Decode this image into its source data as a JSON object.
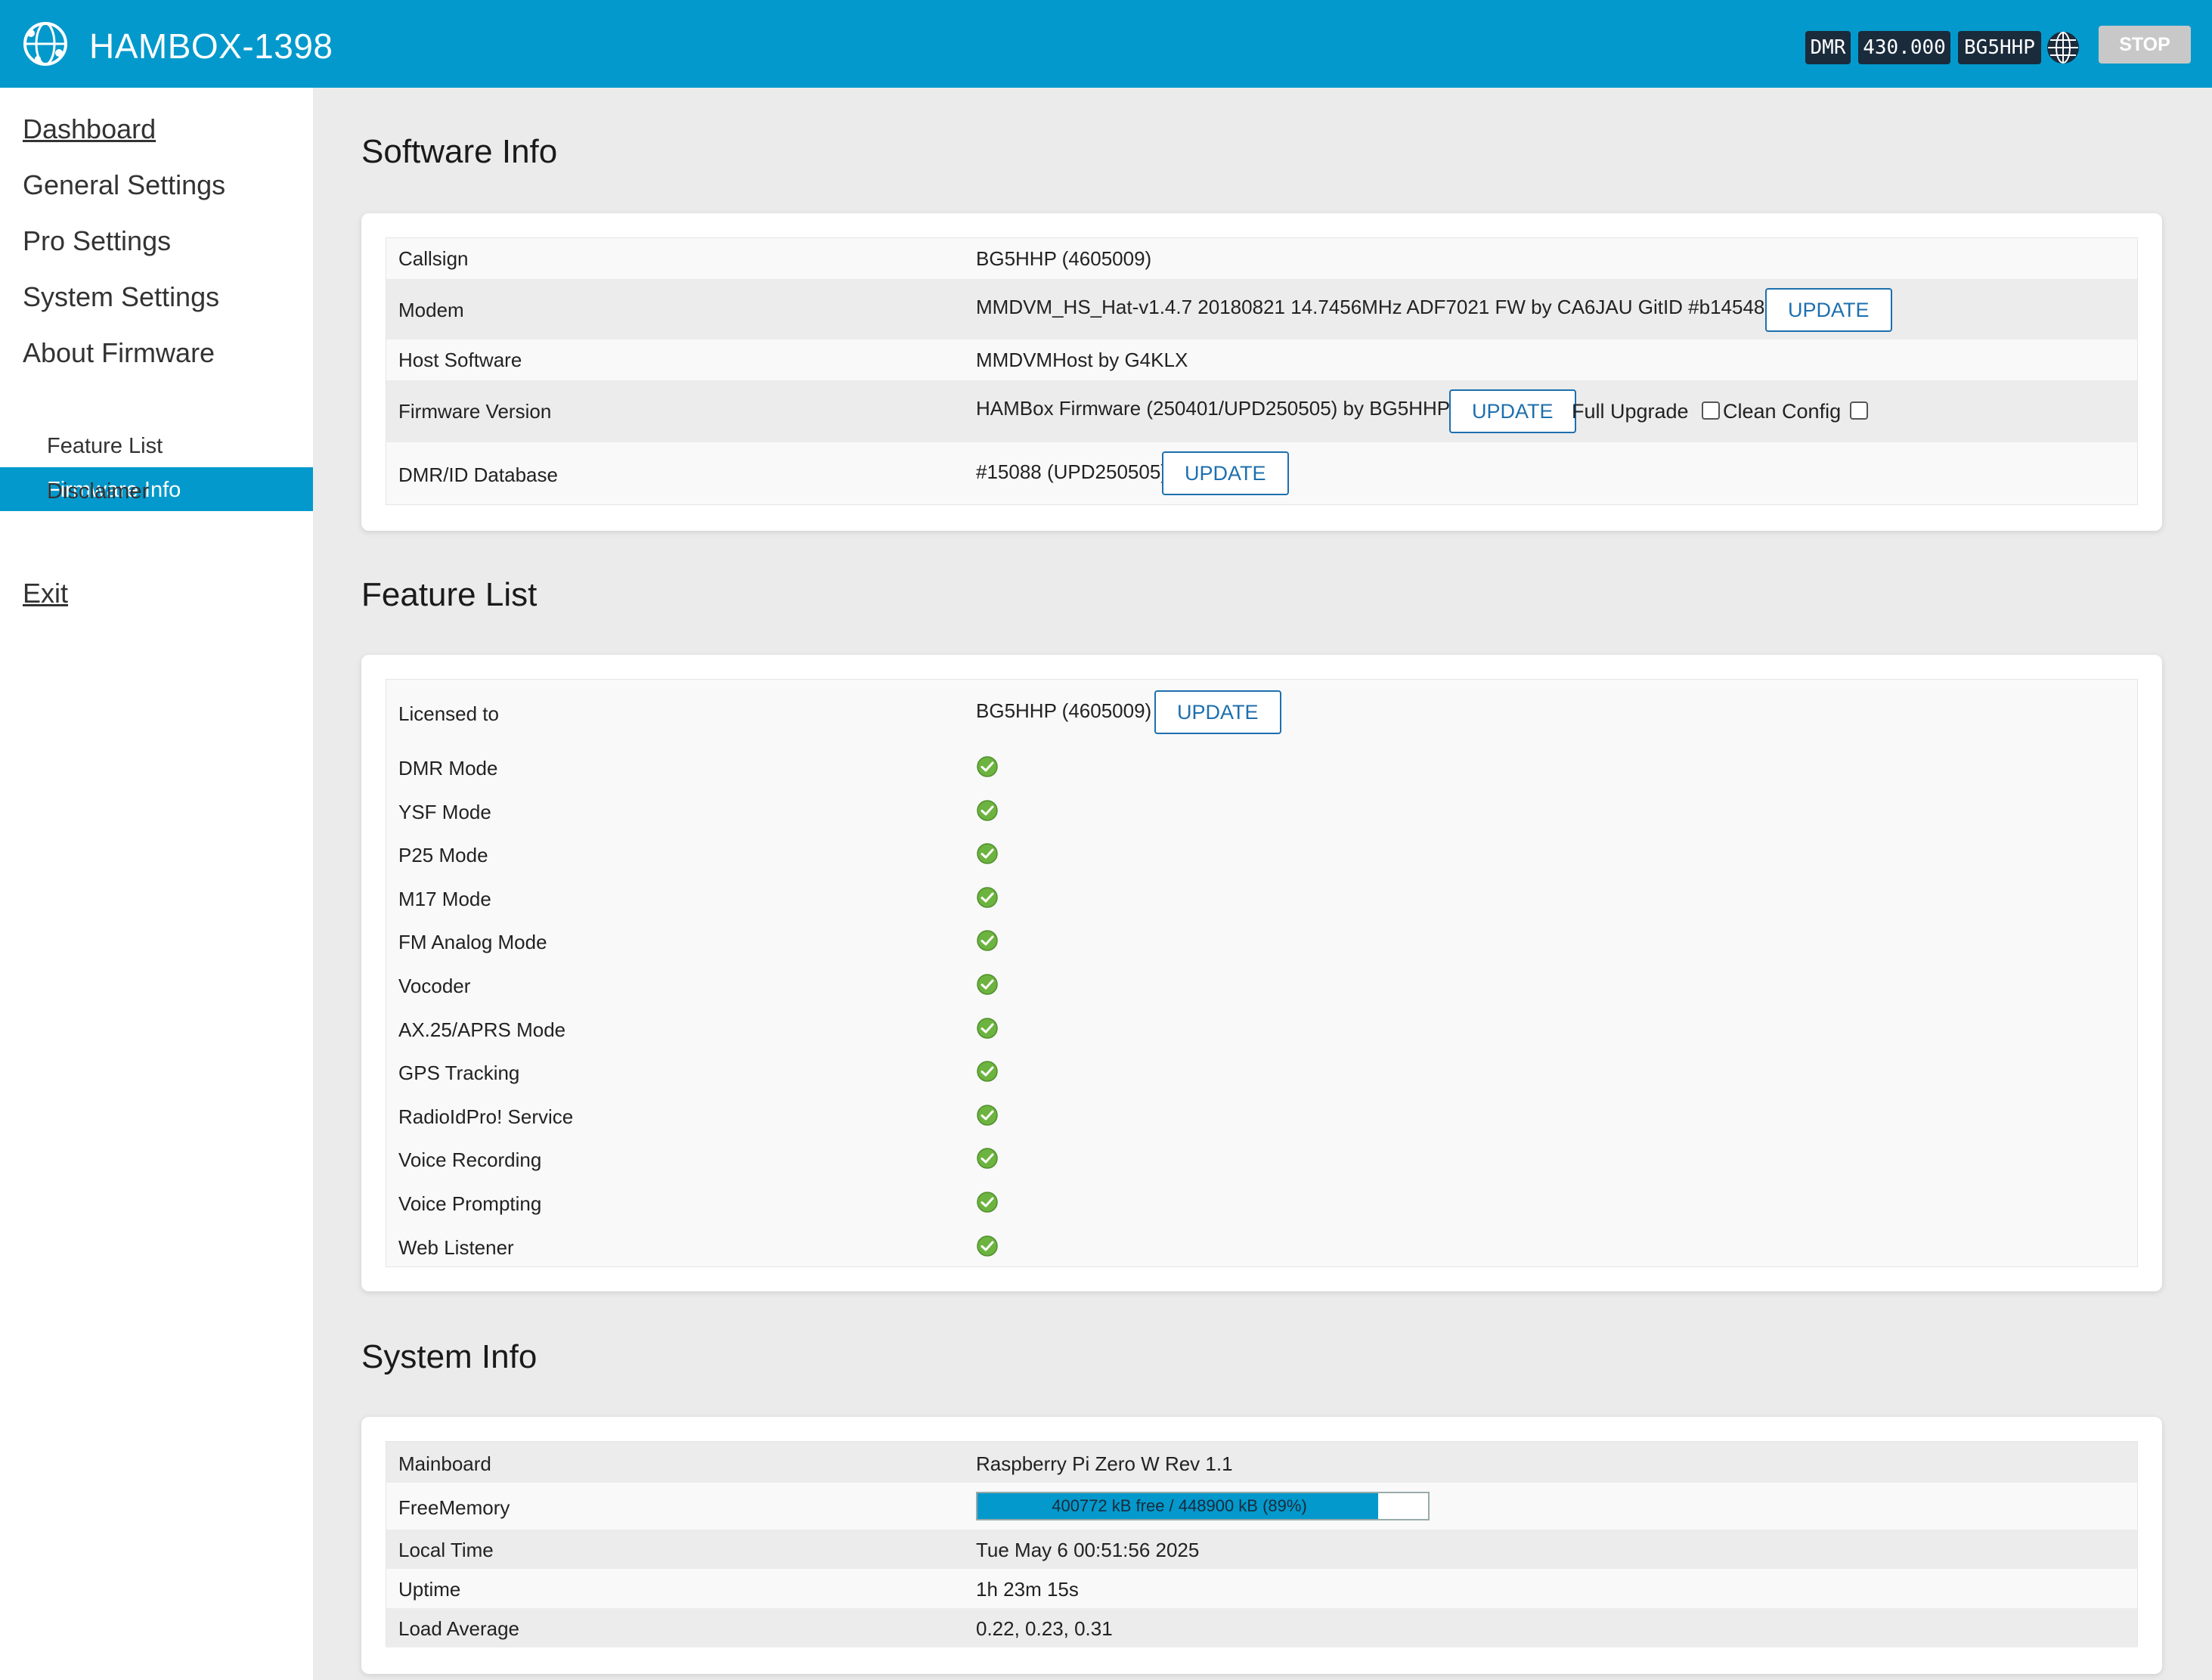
{
  "header": {
    "title": "HAMBOX-1398",
    "mode": "DMR",
    "frequency": "430.000",
    "callsign": "BG5HHP",
    "stop_label": "STOP"
  },
  "sidebar": {
    "items": [
      {
        "label": "Dashboard"
      },
      {
        "label": "General Settings"
      },
      {
        "label": "Pro Settings"
      },
      {
        "label": "System Settings"
      },
      {
        "label": "About Firmware"
      }
    ],
    "sub_items": [
      {
        "label": "Firmware Info",
        "active": true
      },
      {
        "label": "Feature List"
      },
      {
        "label": "Disclaimer"
      }
    ],
    "exit_label": "Exit"
  },
  "software_info": {
    "title": "Software Info",
    "rows": [
      {
        "label": "Callsign",
        "value": "BG5HHP (4605009)"
      },
      {
        "label": "Modem",
        "value": "MMDVM_HS_Hat-v1.4.7 20180821 14.7456MHz ADF7021 FW by CA6JAU GitID #b14548e"
      },
      {
        "label": "Host Software",
        "value": "MMDVMHost by G4KLX"
      },
      {
        "label": "Firmware Version",
        "value": "HAMBox Firmware (250401/UPD250505) by BG5HHP"
      },
      {
        "label": "DMR/ID Database",
        "value": "#15088 (UPD250505)"
      }
    ],
    "update_label": "UPDATE",
    "full_upgrade_label": "Full Upgrade",
    "clean_config_label": "Clean Config"
  },
  "feature_list": {
    "title": "Feature List",
    "licensed_label": "Licensed to",
    "licensed_value": "BG5HHP (4605009)",
    "update_label": "UPDATE",
    "features": [
      {
        "label": "DMR Mode",
        "enabled": true
      },
      {
        "label": "YSF Mode",
        "enabled": true
      },
      {
        "label": "P25 Mode",
        "enabled": true
      },
      {
        "label": "M17 Mode",
        "enabled": true
      },
      {
        "label": "FM Analog Mode",
        "enabled": true
      },
      {
        "label": "Vocoder",
        "enabled": true
      },
      {
        "label": "AX.25/APRS Mode",
        "enabled": true
      },
      {
        "label": "GPS Tracking",
        "enabled": true
      },
      {
        "label": "RadioIdPro! Service",
        "enabled": true
      },
      {
        "label": "Voice Recording",
        "enabled": true
      },
      {
        "label": "Voice Prompting",
        "enabled": true
      },
      {
        "label": "Web Listener",
        "enabled": true
      }
    ]
  },
  "system_info": {
    "title": "System Info",
    "rows": [
      {
        "label": "Mainboard",
        "value": "Raspberry Pi Zero W Rev 1.1"
      },
      {
        "label": "FreeMemory",
        "value": "400772 kB free / 448900 kB (89%)",
        "percent": 89
      },
      {
        "label": "Local Time",
        "value": "Tue May 6 00:51:56 2025"
      },
      {
        "label": "Uptime",
        "value": "1h 23m 15s"
      },
      {
        "label": "Load Average",
        "value": "0.22, 0.23, 0.31"
      }
    ]
  },
  "colors": {
    "brand": "#0399cc",
    "button_text": "#1d6fae",
    "check_green": "#6cb33f"
  }
}
